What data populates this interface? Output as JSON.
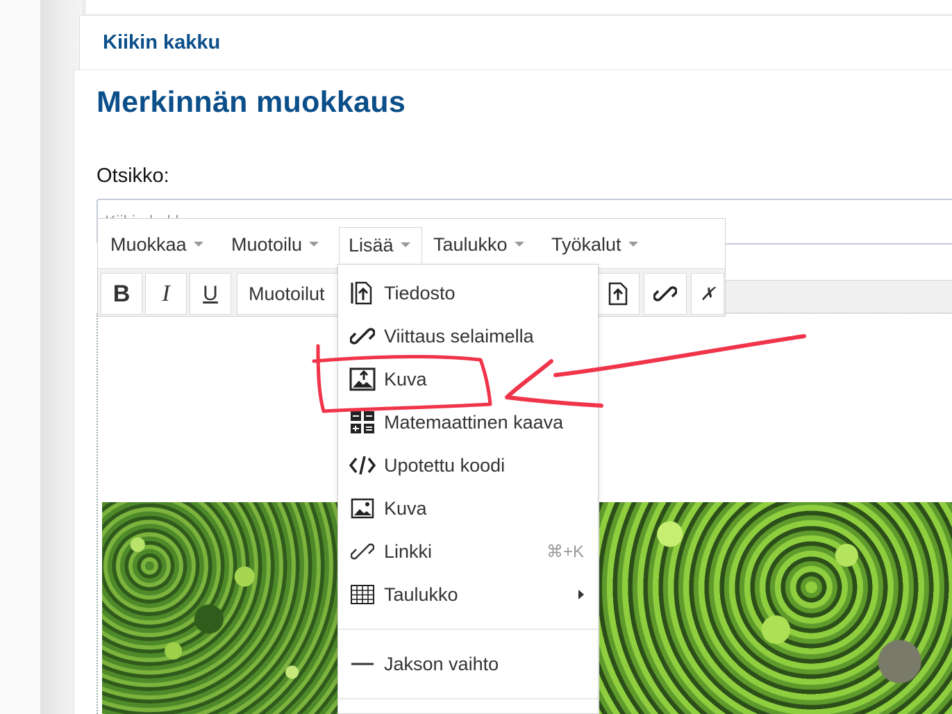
{
  "site": {
    "title": "Kiikin kakku"
  },
  "page": {
    "title": "Merkinnän muokkaus"
  },
  "form": {
    "title_label": "Otsikko:",
    "title_value": "Kiikin kakku"
  },
  "menubar": {
    "items": [
      {
        "label": "Muokkaa"
      },
      {
        "label": "Muotoilu"
      },
      {
        "label": "Lisää"
      },
      {
        "label": "Taulukko"
      },
      {
        "label": "Työkalut"
      }
    ],
    "active": "Lisää"
  },
  "toolbar": {
    "bold": "B",
    "italic": "I",
    "underline": "U",
    "formats_label": "Muotoilut",
    "clear": "✗"
  },
  "insert_menu": {
    "items": [
      {
        "label": "Tiedosto",
        "icon": "file-upload-icon"
      },
      {
        "label": "Viittaus selaimella",
        "icon": "link-browse-icon"
      },
      {
        "label": "Kuva",
        "icon": "image-upload-icon"
      },
      {
        "label": "Matemaattinen kaava",
        "icon": "math-formula-icon"
      },
      {
        "label": "Upotettu koodi",
        "icon": "code-icon"
      },
      {
        "label": "Kuva",
        "icon": "image-icon"
      },
      {
        "label": "Linkki",
        "icon": "link-icon",
        "shortcut": "⌘+K"
      },
      {
        "label": "Taulukko",
        "icon": "table-icon",
        "submenu": true
      },
      {
        "label": "Jakson vaihto",
        "icon": "horizontal-rule-icon"
      }
    ]
  },
  "colors": {
    "brand_blue": "#0b4f8a",
    "annotation_red": "#f0354a"
  }
}
